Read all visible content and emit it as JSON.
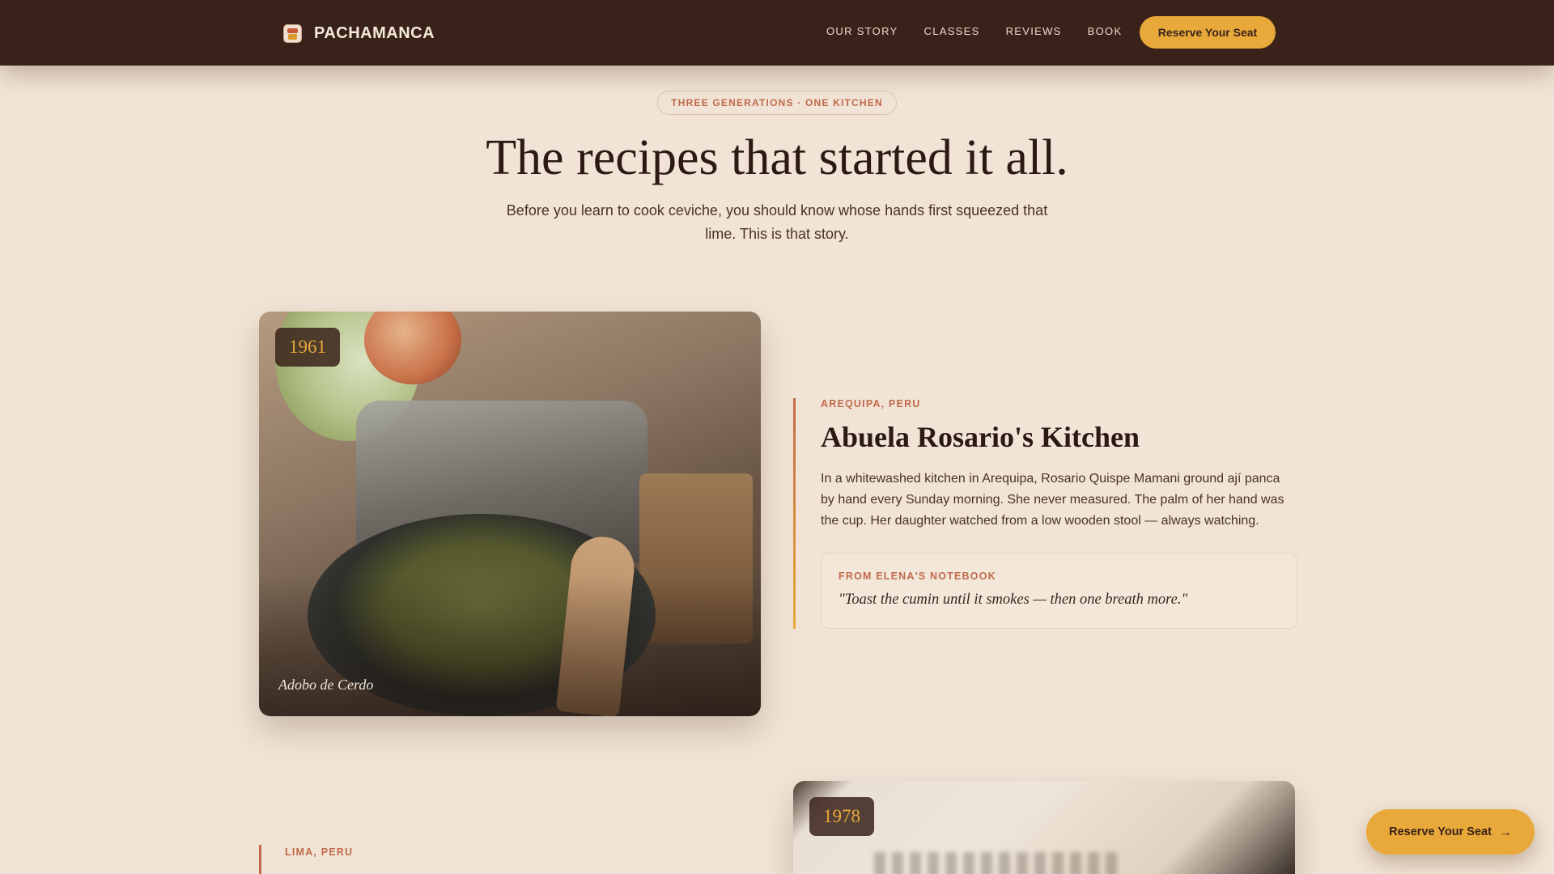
{
  "brand": {
    "name": "PACHAMANCA"
  },
  "nav": {
    "links": [
      "OUR STORY",
      "CLASSES",
      "REVIEWS",
      "BOOK"
    ],
    "cta_label": "Reserve Your Seat"
  },
  "hero": {
    "eyebrow": "THREE GENERATIONS · ONE KITCHEN",
    "title": "The recipes that started it all.",
    "subtitle": "Before you learn to cook ceviche, you should know whose hands first squeezed that lime. This is that story."
  },
  "stories": [
    {
      "year": "1961",
      "caption": "Adobo de Cerdo",
      "location": "AREQUIPA, PERU",
      "title": "Abuela Rosario's Kitchen",
      "body": "In a whitewashed kitchen in Arequipa, Rosario Quispe Mamani ground ají panca by hand every Sunday morning. She never measured. The palm of her hand was the cup. Her daughter watched from a low wooden stool — always watching.",
      "note_label": "FROM ELENA'S NOTEBOOK",
      "note_quote": "\"Toast the cumin until it smokes — then one breath more.\""
    },
    {
      "year": "1978",
      "location": "LIMA, PERU"
    }
  ],
  "floating_cta": {
    "label": "Reserve Your Seat",
    "arrow": "→"
  },
  "colors": {
    "nav_bg": "#3a221a",
    "page_bg": "#f1e4d6",
    "accent": "#e8a93a",
    "terracotta": "#c06a4b"
  }
}
